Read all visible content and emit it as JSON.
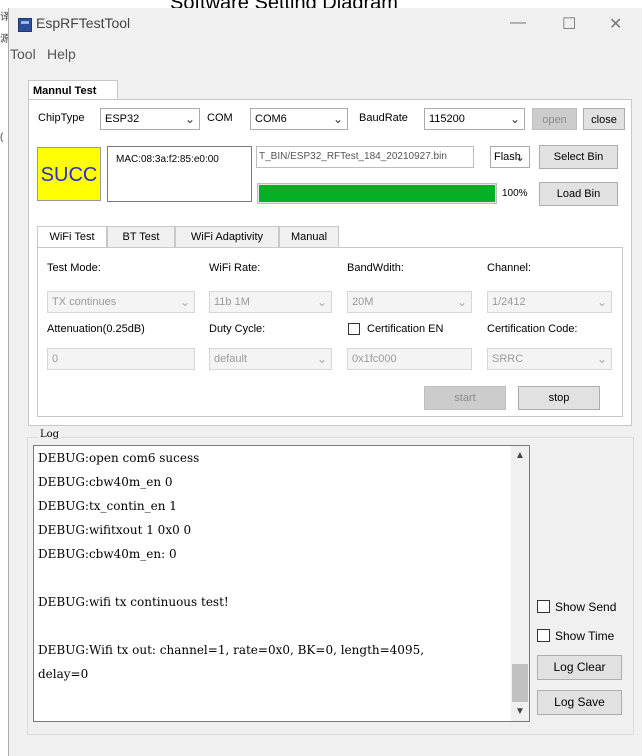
{
  "caption": "Software Setting Diagram",
  "left_edge": [
    "译",
    "源",
    "(",
    "("
  ],
  "window": {
    "title": "EspRFTestTool",
    "minimize": "—",
    "maximize": "☐",
    "close": "✕"
  },
  "menu": [
    "Tool",
    "Help"
  ],
  "main_tab": "Mannul Test",
  "top": {
    "chiptype_label": "ChipType",
    "chiptype_value": "ESP32",
    "com_label": "COM",
    "com_value": "COM6",
    "baud_label": "BaudRate",
    "baud_value": "115200",
    "open_label": "open",
    "close_label": "close",
    "status": "SUCC",
    "mac": "MAC:08:3a:f2:85:e0:00",
    "bin_path": "T_BIN/ESP32_RFTest_184_20210927.bin",
    "flash_value": "Flash",
    "select_bin_label": "Select Bin",
    "progress_percent": 100,
    "progress_text": "100%",
    "load_bin_label": "Load Bin"
  },
  "subtabs": [
    "WiFi Test",
    "BT Test",
    "WiFi Adaptivity",
    "Manual"
  ],
  "wifi": {
    "test_mode_label": "Test Mode:",
    "test_mode_value": "TX continues",
    "rate_label": "WiFi Rate:",
    "rate_value": "11b 1M",
    "bw_label": "BandWdith:",
    "bw_value": "20M",
    "channel_label": "Channel:",
    "channel_value": "1/2412",
    "atten_label": "Attenuation(0.25dB)",
    "atten_value": "0",
    "duty_label": "Duty Cycle:",
    "duty_value": "default",
    "cert_en_label": "Certification EN",
    "cert_en_value": "0x1fc000",
    "cert_code_label": "Certification Code:",
    "cert_code_value": "SRRC",
    "start_label": "start",
    "stop_label": "stop"
  },
  "log": {
    "label": "Log",
    "lines": [
      "DEBUG:open com6 sucess",
      "DEBUG:cbw40m_en 0",
      "DEBUG:tx_contin_en 1",
      "DEBUG:wifitxout 1 0x0 0",
      "DEBUG:cbw40m_en: 0",
      "",
      "DEBUG:wifi tx continuous test!",
      "",
      "DEBUG:Wifi tx out: channel=1, rate=0x0, BK=0, length=4095,",
      "delay=0"
    ],
    "show_send": "Show Send",
    "show_time": "Show Time",
    "log_clear": "Log Clear",
    "log_save": "Log Save"
  },
  "colors": {
    "status_bg": "#ffff00",
    "status_text": "#2a2ad8",
    "progress": "#06b025"
  }
}
